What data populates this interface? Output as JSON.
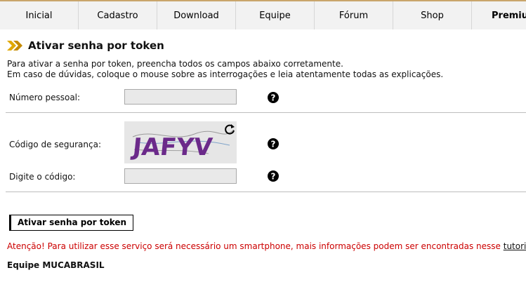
{
  "nav": {
    "items": [
      "Inicial",
      "Cadastro",
      "Download",
      "Equipe",
      "Fórum",
      "Shop",
      "Premium"
    ]
  },
  "page": {
    "title": "Ativar senha por token",
    "intro_line1": "Para ativar a senha por token, preencha todos os campos abaixo corretamente.",
    "intro_line2": "Em caso de dúvidas, coloque o mouse sobre as interrogações e leia atentamente todas as explicações."
  },
  "form": {
    "personal_number_label": "Número pessoal:",
    "personal_number_value": "",
    "security_code_label": "Código de segurança:",
    "captcha_text": "JAFYV",
    "enter_code_label": "Digite o código:",
    "enter_code_value": "",
    "submit_label": "Ativar senha por token"
  },
  "footer": {
    "warning_text": "Atenção! Para utilizar esse serviço será necessário um smartphone, mais informações podem ser encontradas nesse ",
    "tutorial_link": "tutorial",
    "warning_end": ".",
    "signature": "Equipe MUCABRASIL"
  },
  "colors": {
    "accent": "#e0a800",
    "warning": "#cc0000",
    "captcha_text": "#6b2a8a"
  }
}
